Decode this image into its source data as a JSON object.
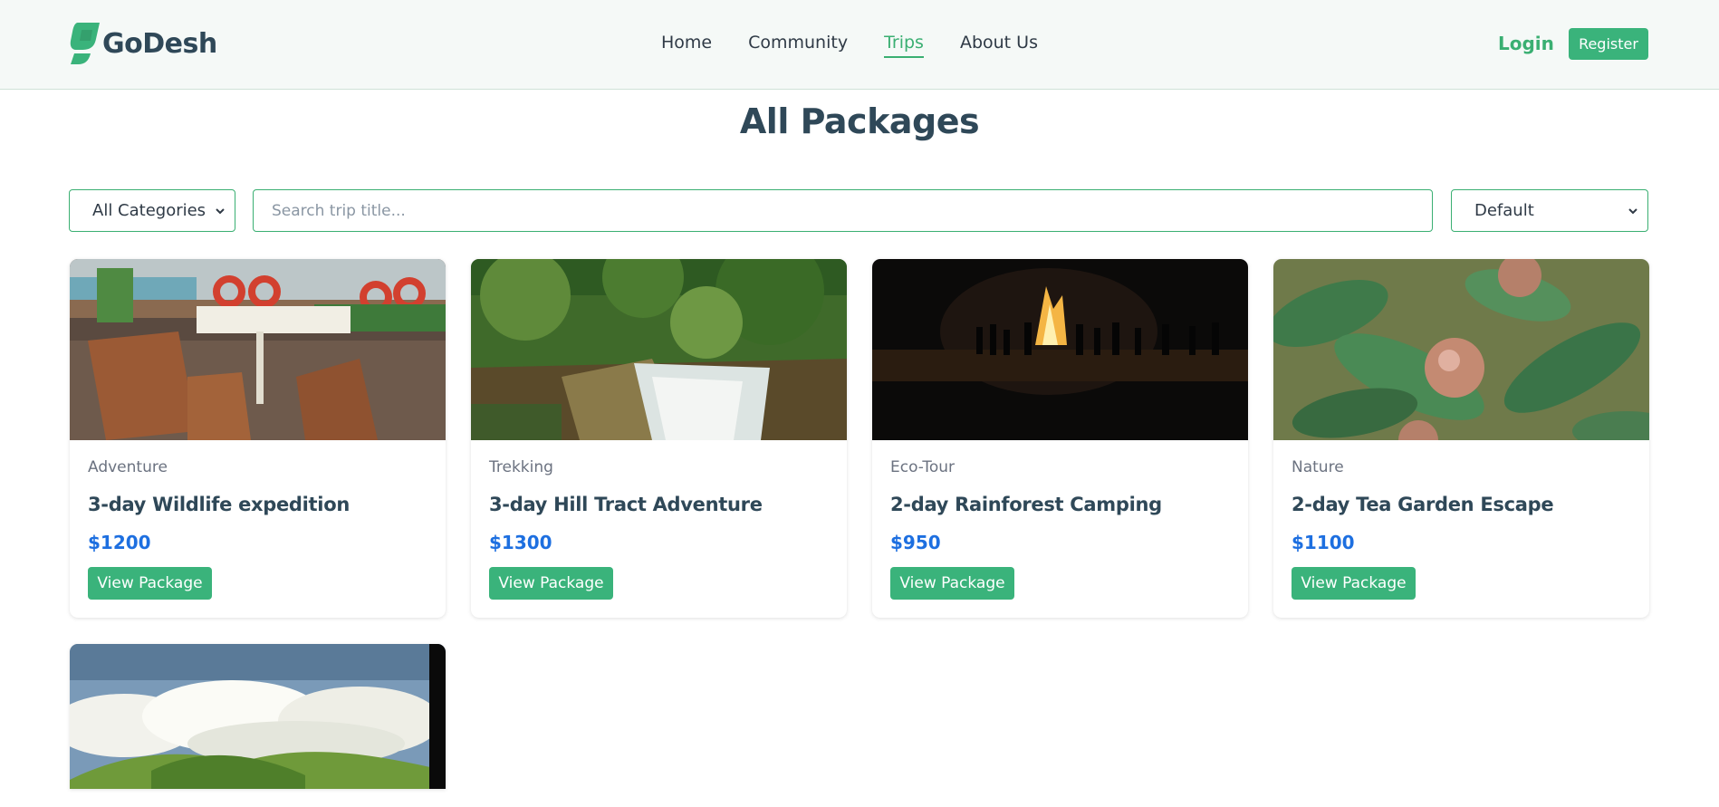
{
  "brand": {
    "name": "GoDesh",
    "icon": "godesh-logo-icon",
    "accent": "#3ab37b"
  },
  "nav": {
    "items": [
      {
        "label": "Home",
        "active": false
      },
      {
        "label": "Community",
        "active": false
      },
      {
        "label": "Trips",
        "active": true
      },
      {
        "label": "About Us",
        "active": false
      }
    ],
    "login_label": "Login",
    "register_label": "Register"
  },
  "page": {
    "title": "All Packages"
  },
  "filters": {
    "category_selected": "All Categories",
    "search_placeholder": "Search trip title...",
    "search_value": "",
    "sort_selected": "Default"
  },
  "packages": [
    {
      "category": "Adventure",
      "title": "3-day Wildlife expedition",
      "price": "$1200",
      "button": "View Package",
      "image": "ship-deck-patio-photo"
    },
    {
      "category": "Trekking",
      "title": "3-day Hill Tract Adventure",
      "price": "$1300",
      "button": "View Package",
      "image": "forest-waterfall-photo"
    },
    {
      "category": "Eco-Tour",
      "title": "2-day Rainforest Camping",
      "price": "$950",
      "button": "View Package",
      "image": "night-bonfire-photo"
    },
    {
      "category": "Nature",
      "title": "2-day Tea Garden Escape",
      "price": "$1100",
      "button": "View Package",
      "image": "fruit-leaves-photo"
    },
    {
      "image": "green-hills-clouds-photo"
    }
  ],
  "colors": {
    "primary": "#3ab37b",
    "price": "#1d6fe0",
    "heading": "#2f4858"
  }
}
